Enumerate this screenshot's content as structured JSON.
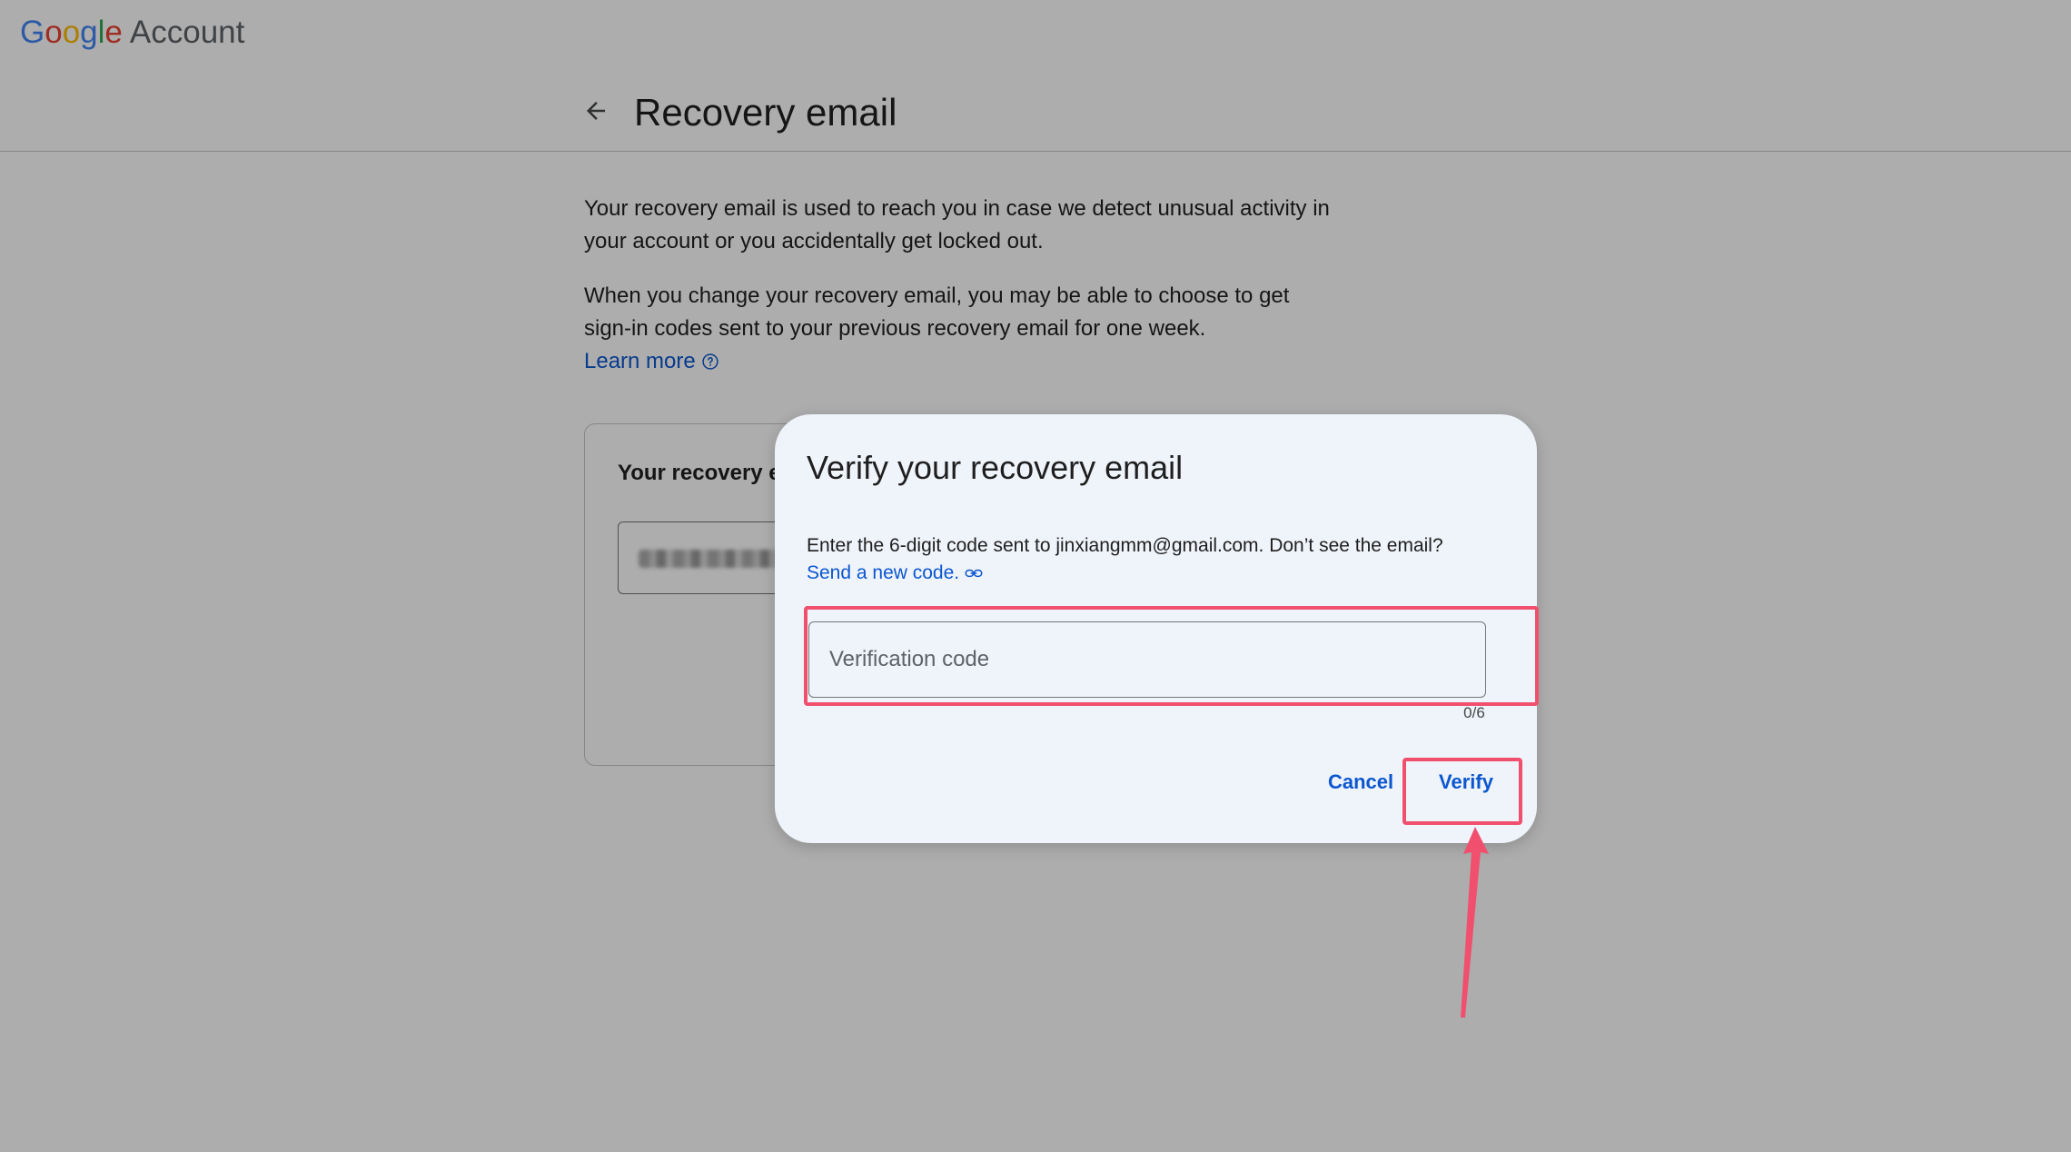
{
  "header": {
    "brand_letters": [
      "G",
      "o",
      "o",
      "g",
      "l",
      "e"
    ],
    "brand_suffix": "Account"
  },
  "page": {
    "title": "Recovery email",
    "back_icon": "arrow-back-icon",
    "paragraph_1": "Your recovery email is used to reach you in case we detect unusual activity in your account or you accidentally get locked out.",
    "paragraph_2": "When you change your recovery email, you may be able to choose to get sign-in codes sent to your previous recovery email for one week.",
    "learn_more": "Learn more",
    "learn_more_icon": "help-circle-icon"
  },
  "card": {
    "title": "Your recovery e"
  },
  "dialog": {
    "title": "Verify your recovery email",
    "instruction": "Enter the 6-digit code sent to jinxiangmm@gmail.com. Don’t see the email?",
    "send_link": "Send a new code.",
    "send_link_icon": "link-icon",
    "code_placeholder": "Verification code",
    "code_value": "",
    "counter": "0/6",
    "cancel_label": "Cancel",
    "verify_label": "Verify"
  },
  "colors": {
    "accent_blue": "#0b57d0",
    "annotation": "#f0506e",
    "dialog_bg": "#eff3fa",
    "scrim": "rgba(0,0,0,0.32)"
  }
}
